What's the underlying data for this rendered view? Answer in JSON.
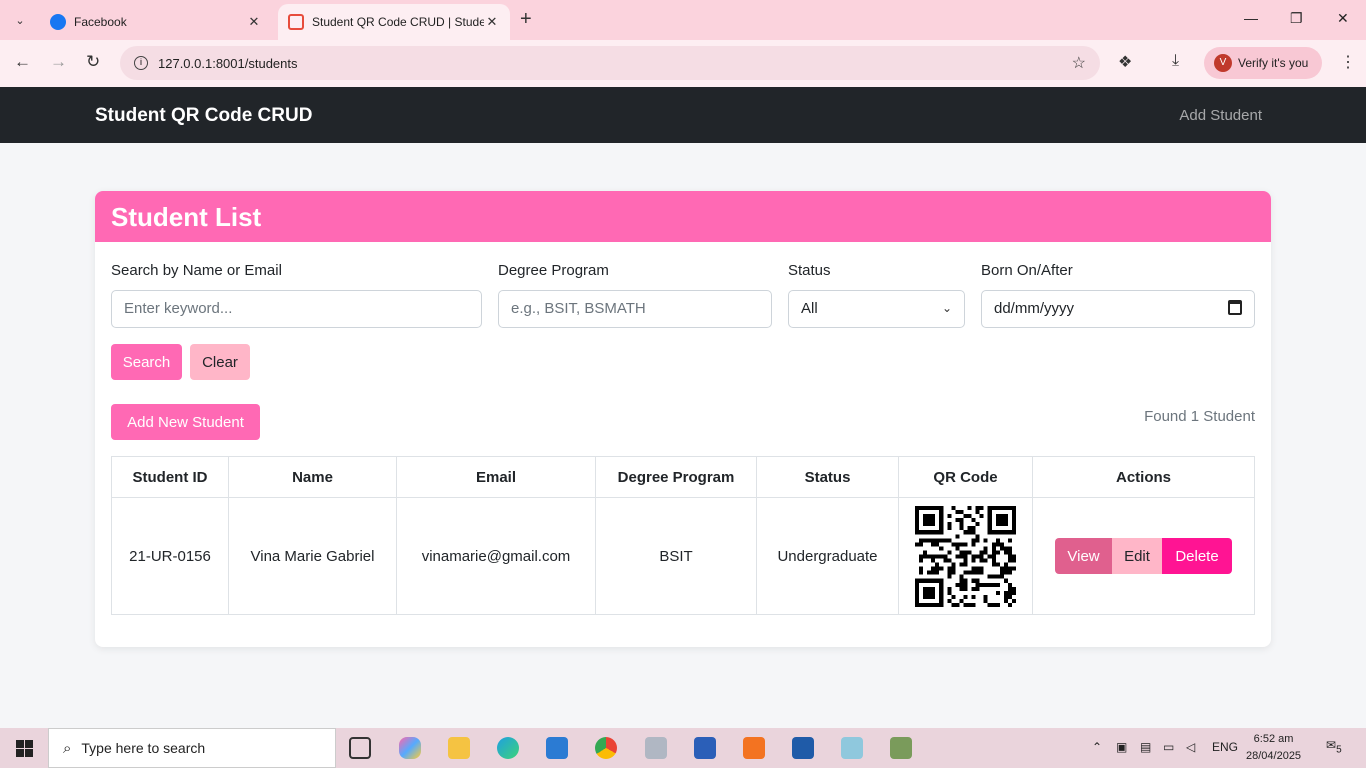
{
  "browser": {
    "tabs": [
      {
        "title": "Facebook",
        "active": false
      },
      {
        "title": "Student QR Code CRUD | Stude",
        "active": true
      }
    ],
    "url": "127.0.0.1:8001/students",
    "profile_button": "Verify it's you",
    "profile_initial": "V"
  },
  "navbar": {
    "brand": "Student QR Code CRUD",
    "link": "Add Student"
  },
  "card": {
    "title": "Student List",
    "filters": {
      "search_label": "Search by Name or Email",
      "search_placeholder": "Enter keyword...",
      "degree_label": "Degree Program",
      "degree_placeholder": "e.g., BSIT, BSMATH",
      "status_label": "Status",
      "status_value": "All",
      "born_label": "Born On/After",
      "born_placeholder": "dd/mm/yyyy"
    },
    "buttons": {
      "search": "Search",
      "clear": "Clear",
      "add_new": "Add New Student"
    },
    "found_text": "Found 1 Student",
    "table": {
      "headers": [
        "Student ID",
        "Name",
        "Email",
        "Degree Program",
        "Status",
        "QR Code",
        "Actions"
      ],
      "rows": [
        {
          "id": "21-UR-0156",
          "name": "Vina Marie Gabriel",
          "email": "vinamarie@gmail.com",
          "degree": "BSIT",
          "status": "Undergraduate"
        }
      ],
      "actions": {
        "view": "View",
        "edit": "Edit",
        "delete": "Delete"
      }
    }
  },
  "taskbar": {
    "search_placeholder": "Type here to search",
    "language": "ENG",
    "time": "6:52 am",
    "date": "28/04/2025",
    "notification_count": "5"
  },
  "colors": {
    "accent": "#ff69b4",
    "navbar": "#212529",
    "danger": "#ff1493"
  }
}
